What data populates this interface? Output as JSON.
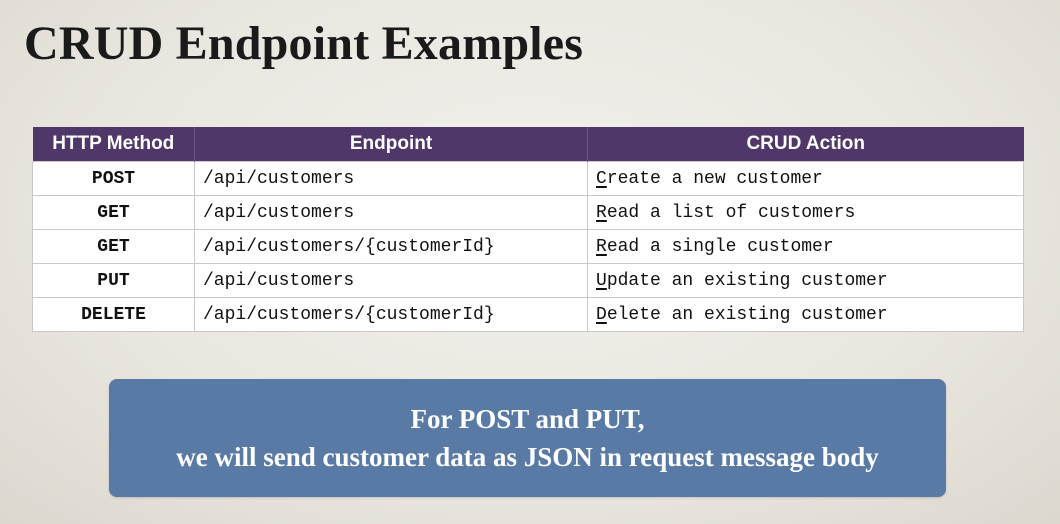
{
  "title": "CRUD Endpoint Examples",
  "table": {
    "headers": [
      "HTTP Method",
      "Endpoint",
      "CRUD Action"
    ],
    "rows": [
      {
        "method": "POST",
        "endpoint": "/api/customers",
        "action_initial": "C",
        "action_rest": "reate a new customer"
      },
      {
        "method": "GET",
        "endpoint": "/api/customers",
        "action_initial": "R",
        "action_rest": "ead a list of customers"
      },
      {
        "method": "GET",
        "endpoint": "/api/customers/{customerId}",
        "action_initial": "R",
        "action_rest": "ead a single customer"
      },
      {
        "method": "PUT",
        "endpoint": "/api/customers",
        "action_initial": "U",
        "action_rest": "pdate an existing customer"
      },
      {
        "method": "DELETE",
        "endpoint": "/api/customers/{customerId}",
        "action_initial": "D",
        "action_rest": "elete an existing customer"
      }
    ]
  },
  "note": {
    "line1": "For POST and PUT,",
    "line2": "we will send customer data as JSON in request message body"
  },
  "colors": {
    "header_bg": "#4f3769",
    "note_bg": "#587aa5"
  }
}
